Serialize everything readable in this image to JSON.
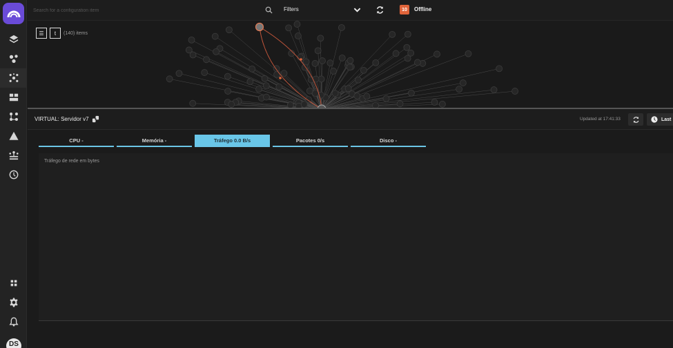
{
  "sidebar": {
    "items": [
      {
        "icon": "layers-icon"
      },
      {
        "icon": "nodes-icon"
      },
      {
        "icon": "network-icon"
      },
      {
        "icon": "dashboard-icon"
      },
      {
        "icon": "workflow-icon"
      },
      {
        "icon": "alert-icon"
      },
      {
        "icon": "topology-icon"
      },
      {
        "icon": "history-icon"
      }
    ],
    "bottom_items": [
      {
        "icon": "apps-icon"
      },
      {
        "icon": "gear-icon"
      },
      {
        "icon": "bell-icon"
      }
    ],
    "avatar_initials": "DS"
  },
  "topbar": {
    "search_placeholder": "Search for a configuration item",
    "filters_label": "Filters",
    "offline_count": "10",
    "offline_label": "Offline"
  },
  "graph": {
    "view_toggle_list": "☰",
    "view_toggle_tree": "t",
    "item_count": "(140) items"
  },
  "detail": {
    "title": "VIRTUAL: Servidor v7",
    "updated": "Updated at 17:41:33",
    "last_label": "Last",
    "tabs": [
      {
        "label": "CPU -"
      },
      {
        "label": "Memória -"
      },
      {
        "label": "Tráfego 0.0 B/s"
      },
      {
        "label": "Pacotes 0/s"
      },
      {
        "label": "Disco -"
      }
    ],
    "active_tab": 2,
    "chart_label": "Tráfego de rede em bytes"
  },
  "colors": {
    "brand": "#6a4bd8",
    "accent": "#69c6e8",
    "offline": "#e0643a"
  }
}
